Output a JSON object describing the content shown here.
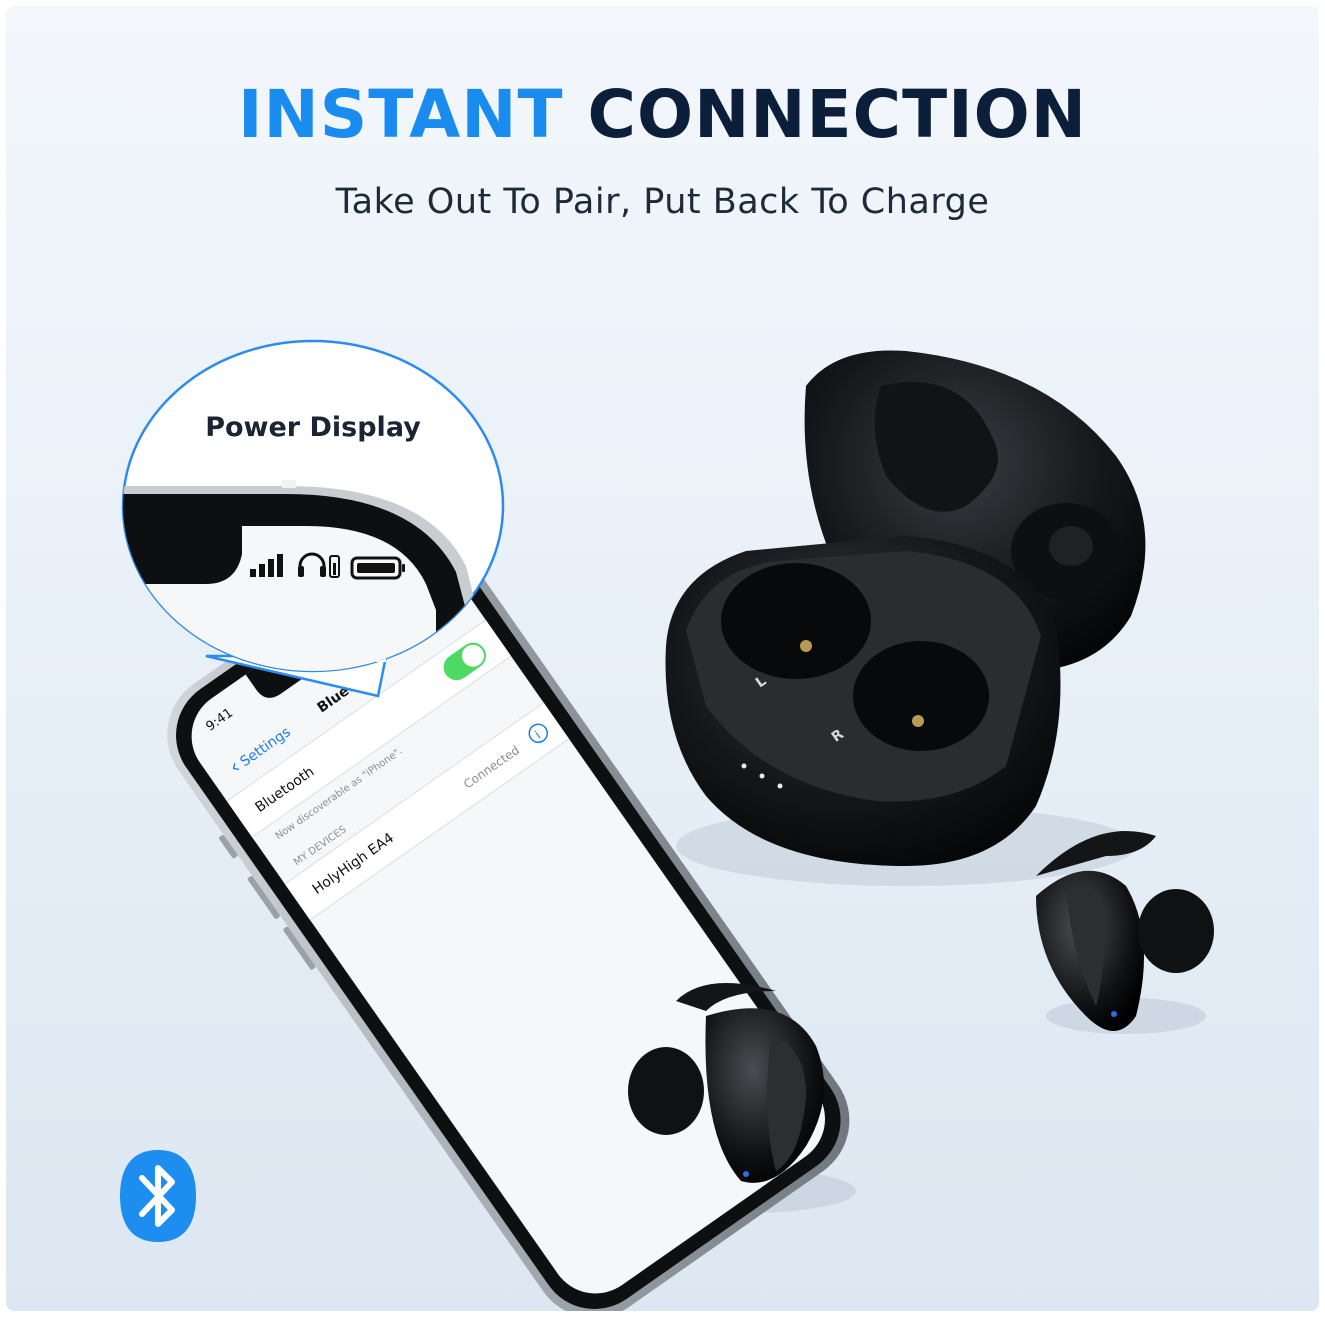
{
  "headline": {
    "accent": "INSTANT",
    "main": "CONNECTION"
  },
  "subtitle": "Take Out To Pair, Put Back To Charge",
  "callout": {
    "label": "Power Display"
  },
  "phone": {
    "time": "9:41",
    "back_label": "Settings",
    "nav_title": "Bluetooth",
    "row_label": "Bluetooth",
    "discoverable_note": "Now discoverable as \"iPhone\".",
    "section_header": "MY DEVICES",
    "device_name": "HolyHigh EA4",
    "device_status": "Connected",
    "toggle_on": true
  },
  "case": {
    "left_marker": "L",
    "right_marker": "R"
  },
  "colors": {
    "accent": "#1a8cf0",
    "headline_dark": "#0b1f3a",
    "toggle_green": "#4cd964",
    "bluetooth_blue": "#1d8ef0"
  },
  "icons": [
    "signal-bars-icon",
    "headphone-battery-icon",
    "battery-icon",
    "bluetooth-icon",
    "info-icon"
  ]
}
